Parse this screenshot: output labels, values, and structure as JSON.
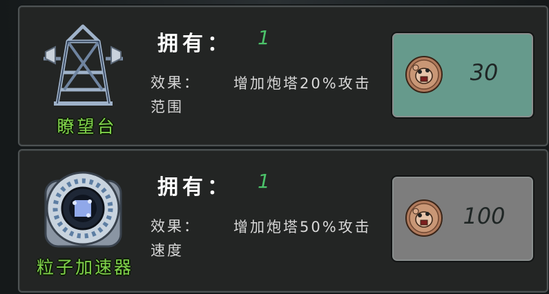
{
  "items": [
    {
      "name": "瞭望台",
      "own_label": "拥有：",
      "own_count": "1",
      "effect_label": "效果：",
      "effect_text": "增加炮塔20%攻击范围",
      "price": "30",
      "button_color": "#669a8c"
    },
    {
      "name": "粒子加速器",
      "own_label": "拥有：",
      "own_count": "1",
      "effect_label": "效果：",
      "effect_text": "增加炮塔50%攻击速度",
      "price": "100",
      "button_color": "#7d7d7d"
    }
  ],
  "colors": {
    "name_green": "#7fd14a",
    "count_green": "#4cc36a",
    "panel_bg": "#232524"
  }
}
